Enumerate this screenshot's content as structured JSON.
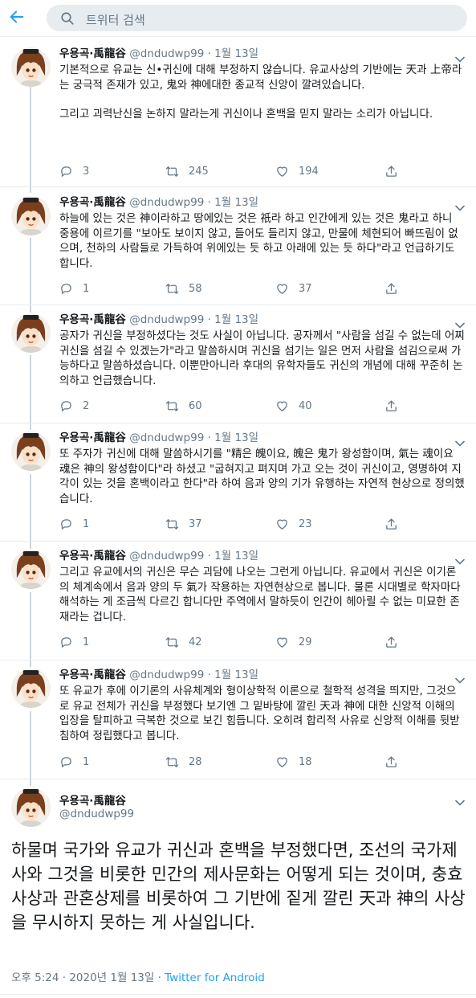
{
  "search": {
    "placeholder": "트위터 검색"
  },
  "colors": {
    "accent": "#1da1f2",
    "muted": "#657786",
    "text": "#14171a",
    "thread_line": "#ccd6dd",
    "search_bg": "#e6ecf0"
  },
  "icons": {
    "back": "arrow-left-icon",
    "search": "search-icon",
    "reply": "reply-icon",
    "retweet": "retweet-icon",
    "like": "heart-icon",
    "share": "share-icon",
    "menu": "chevron-down-icon"
  },
  "tweets": [
    {
      "name": "우용곡·禹龍谷",
      "meta": "@dndudwp99 · 1월 13일",
      "paragraphs": [
        "기본적으로 유교는 신•귀신에 대해 부정하지 않습니다. 유교사상의 기반에는 天과 上帝라는 궁극적 존재가 있고, 鬼와 神에대한 종교적 신앙이 깔려있습니다.",
        "그리고 괴력난신을 논하지 말라는게 귀신이나 혼백을 믿지 말라는 소리가 아닙니다."
      ],
      "replies": "3",
      "retweets": "245",
      "likes": "194"
    },
    {
      "name": "우용곡·禹龍谷",
      "meta": "@dndudwp99 · 1월 13일",
      "paragraphs": [
        "하늘에 있는 것은 神이라하고 땅에있는 것은 祇라 하고 인간에게 있는 것은 鬼라고 하니 중용에 이르기를 \"보아도 보이지 않고, 들어도 들리지 않고, 만물에 체현되어 빠뜨림이 없으며, 천하의 사람들로 가득하여 위에있는 듯 하고 아래에 있는 듯 하다\"라고 언급하기도 합니다."
      ],
      "replies": "1",
      "retweets": "58",
      "likes": "37"
    },
    {
      "name": "우용곡·禹龍谷",
      "meta": "@dndudwp99 · 1월 13일",
      "paragraphs": [
        "공자가 귀신을 부정하셨다는 것도 사실이 아닙니다. 공자께서 \"사람을 섬길 수 없는데 어찌 귀신을 섬길 수 있겠는가\"라고 말씀하시며 귀신을 섬기는 일은 먼저 사람을 섬김으로써 가능하다고 말씀하셨습니다. 이뿐만아니라 후대의 유학자들도 귀신의 개념에 대해 꾸준히 논의하고 언급했습니다."
      ],
      "replies": "2",
      "retweets": "60",
      "likes": "40"
    },
    {
      "name": "우용곡·禹龍谷",
      "meta": "@dndudwp99 · 1월 13일",
      "paragraphs": [
        "또 주자가 귀신에 대해 말씀하시기를 \"精은 魄이요, 魄은 鬼가 왕성함이며, 氣는 魂이요 魂은 神의 왕성함이다\"라 하셨고 \"굽혀지고 펴지며 가고 오는 것이 귀신이고, 영명하여 지각이 있는 것을 혼백이라고 한다\"라 하여 음과 양의 기가 유행하는 자연적 현상으로 정의했습니다."
      ],
      "replies": "1",
      "retweets": "37",
      "likes": "23"
    },
    {
      "name": "우용곡·禹龍谷",
      "meta": "@dndudwp99 · 1월 13일",
      "paragraphs": [
        "그리고 유교에서의 귀신은 무슨 괴담에 나오는 그런게 아닙니다. 유교에서 귀신은 이기론의 체계속에서 음과 양의 두 氣가 작용하는 자연현상으로 봅니다. 물론 시대별로 학자마다 해석하는 게 조금씩 다르긴 합니다만 주역에서 말하듯이 인간이 헤아릴 수 없는 미묘한 존재라는 겁니다."
      ],
      "replies": "1",
      "retweets": "42",
      "likes": "29"
    },
    {
      "name": "우용곡·禹龍谷",
      "meta": "@dndudwp99 · 1월 13일",
      "paragraphs": [
        "또 유교가 후에 이기론의 사유체계와 형이상학적 이론으로 철학적 성격을 띄지만, 그것으로 유교 전체가 귀신을 부정했다 보기엔 그 밑바탕에 깔린 天과 神에 대한 신앙적 이해의 입장을 탈피하고 극복한 것으로 보긴 힘듭니다. 오히려 합리적 사유로 신앙적 이해를 뒷받침하여 정립했다고 봅니다."
      ],
      "replies": "1",
      "retweets": "28",
      "likes": "18"
    }
  ],
  "main_tweet": {
    "name": "우용곡·禹龍谷",
    "handle": "@dndudwp99",
    "text": "하물며 국가와 유교가 귀신과 혼백을 부정했다면, 조선의 국가제사와 그것을 비롯한 민간의 제사문화는 어떻게 되는 것이며, 충효사상과 관혼상제를 비롯하여 그 기반에 짙게 깔린 天과 神의 사상을 무시하지 못하는 게 사실입니다.",
    "time": "오후 5:24 · 2020년 1월 13일 · ",
    "source": "Twitter for Android"
  }
}
